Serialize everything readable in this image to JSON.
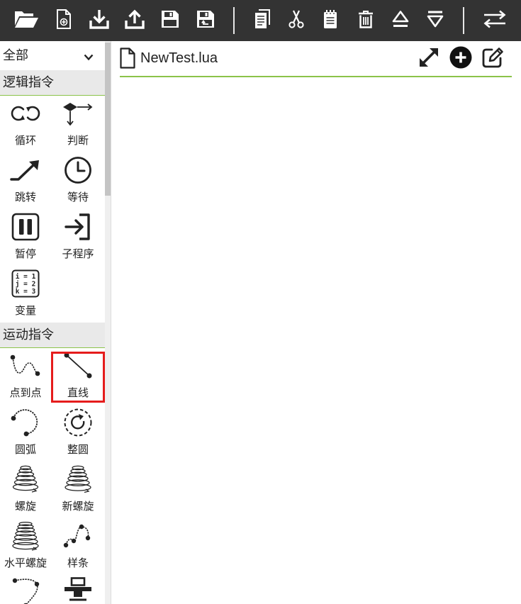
{
  "toolbar": {
    "buttons": [
      {
        "icon": "folder-open-icon"
      },
      {
        "icon": "new-file-icon"
      },
      {
        "icon": "download-icon"
      },
      {
        "icon": "upload-icon"
      },
      {
        "icon": "save-icon"
      },
      {
        "icon": "save-as-icon"
      },
      {
        "icon": "copy-icon"
      },
      {
        "icon": "cut-icon"
      },
      {
        "icon": "notepad-icon"
      },
      {
        "icon": "trash-icon"
      },
      {
        "icon": "move-up-icon"
      },
      {
        "icon": "move-down-icon"
      },
      {
        "icon": "swap-icon"
      }
    ]
  },
  "sidebar": {
    "filter": {
      "selected": "全部",
      "icon": "chevron-down-icon"
    },
    "sections": [
      {
        "title": "逻辑指令",
        "items": [
          {
            "label": "循环",
            "icon": "loop-icon"
          },
          {
            "label": "判断",
            "icon": "branch-icon"
          },
          {
            "label": "跳转",
            "icon": "jump-icon"
          },
          {
            "label": "等待",
            "icon": "clock-icon"
          },
          {
            "label": "暂停",
            "icon": "pause-icon"
          },
          {
            "label": "子程序",
            "icon": "sign-in-icon"
          },
          {
            "label": "变量",
            "icon": "variable-icon",
            "icon_text": [
              "i = 1",
              "j = 2",
              "k = 3"
            ]
          }
        ]
      },
      {
        "title": "运动指令",
        "items": [
          {
            "label": "点到点",
            "icon": "ptp-curve-icon"
          },
          {
            "label": "直线",
            "icon": "line-segment-icon",
            "highlighted": true
          },
          {
            "label": "圆弧",
            "icon": "arc-icon"
          },
          {
            "label": "整圆",
            "icon": "full-circle-icon"
          },
          {
            "label": "螺旋",
            "icon": "spiral-icon"
          },
          {
            "label": "新螺旋",
            "icon": "new-spiral-icon"
          },
          {
            "label": "水平螺旋",
            "icon": "horizontal-spiral-icon"
          },
          {
            "label": "样条",
            "icon": "spline-icon"
          },
          {
            "icon": "spline-points-icon"
          },
          {
            "icon": "tool-icon"
          }
        ]
      }
    ]
  },
  "editor": {
    "filename": "NewTest.lua",
    "file_icon": "file-icon",
    "actions": [
      {
        "icon": "expand-icon"
      },
      {
        "icon": "plus-circle-icon"
      },
      {
        "icon": "edit-icon"
      }
    ]
  },
  "colors": {
    "toolbar_bg": "#333333",
    "accent_green": "#8bc34a",
    "highlight_red": "#e51c1c",
    "section_bg": "#e9e9e9"
  }
}
